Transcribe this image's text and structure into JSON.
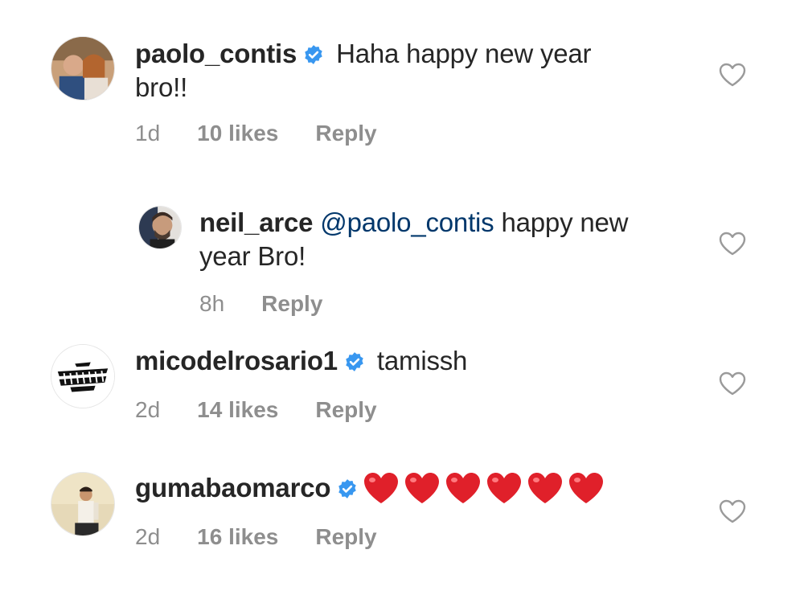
{
  "comments": [
    {
      "username": "paolo_contis",
      "verified": true,
      "text": " Haha happy new year bro!!",
      "time": "1d",
      "likes": "10 likes",
      "reply": "Reply"
    },
    {
      "username": "neil_arce",
      "verified": false,
      "mention": "@paolo_contis",
      "text": " happy new year Bro!",
      "time": "8h",
      "reply": "Reply"
    },
    {
      "username": "micodelrosario1",
      "verified": true,
      "text": " tamissh",
      "time": "2d",
      "likes": "14 likes",
      "reply": "Reply"
    },
    {
      "username": "gumabaomarco",
      "verified": true,
      "emoji": "red-heart",
      "emoji_count": 6,
      "time": "2d",
      "likes": "16 likes",
      "reply": "Reply"
    }
  ],
  "colors": {
    "text": "#262626",
    "muted": "#8e8e8e",
    "mention": "#00376b",
    "verified": "#3897f0",
    "emoji_heart": "#e0202a"
  },
  "icons": {
    "verified": "verified-badge-icon",
    "like": "heart-outline-icon"
  }
}
